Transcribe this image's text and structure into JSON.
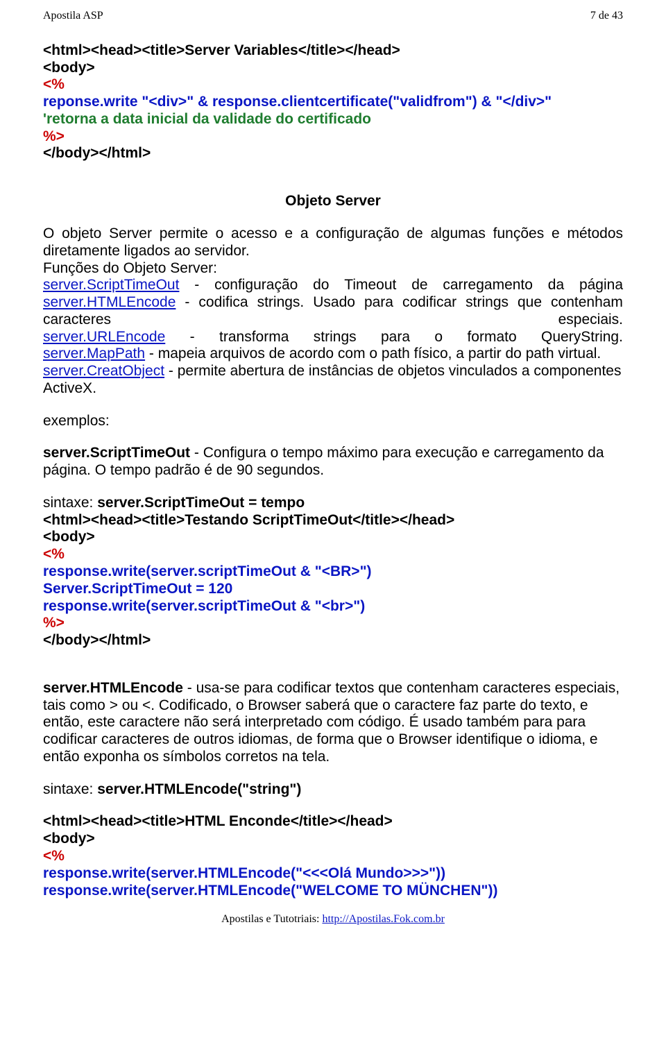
{
  "header": {
    "left": "Apostila ASP",
    "right": "7 de 43"
  },
  "code1": {
    "l1": "<html><head><title>Server Variables</title></head>",
    "l2": "<body>",
    "l3": "<%",
    "l4": "reponse.write \"<div>\" & response.clientcertificate(\"validfrom\") & \"</div>\"",
    "l5": "'retorna a data inicial da validade do certificado",
    "l6": "%>",
    "l7": "</body></html>"
  },
  "server_title": "Objeto Server",
  "server_intro": "O objeto Server permite o acesso e a configuração de algumas funções e métodos diretamente ligados ao servidor.",
  "server_func_label": "Funções do Objeto Server:",
  "srv": {
    "script_label": "server.ScriptTimeOut",
    "script_desc1": " - configuração do Timeout de carregamento da página",
    "html_label": "server.HTMLEncode",
    "html_desc_pre": " - codifica strings. Usado para codificar strings que contenham",
    "html_desc_row": {
      "left": "caracteres",
      "right": "especiais."
    },
    "url_label": "server.URLEncode",
    "url_desc_parts": [
      "-",
      "transforma",
      "strings",
      "para",
      "o",
      "formato",
      "QueryString."
    ],
    "map_label": "server.MapPath",
    "map_desc": " - mapeia arquivos de acordo com o path físico, a partir do path virtual.",
    "creat_label": "server.CreatObject",
    "creat_desc": " - permite abertura de instâncias de objetos vinculados a componentes ActiveX."
  },
  "exemplos_label": "exemplos:",
  "scripttimeout": {
    "label": "server.ScriptTimeOut",
    "desc": " - Configura o tempo máximo para execução e carregamento da página. O tempo padrão é de 90 segundos."
  },
  "syntax1_label": "sintaxe: ",
  "syntax1_val": "server.ScriptTimeOut = tempo",
  "code2": {
    "l1": "<html><head><title>Testando ScriptTimeOut</title></head>",
    "l2": "<body>",
    "l3": "<%",
    "l4": "response.write(server.scriptTimeOut & \"<BR>\")",
    "l5": "Server.ScriptTimeOut = 120",
    "l6": "response.write(server.scriptTimeOut & \"<br>\")",
    "l7": "%>",
    "l8": "</body></html>"
  },
  "htmlencode": {
    "label": "server.HTMLEncode",
    "desc": " - usa-se para codificar textos que contenham caracteres especiais, tais como > ou <. Codificado, o Browser saberá que o caractere faz parte do texto, e então, este caractere não será interpretado com código. É usado também para para codificar caracteres de outros idiomas, de forma que o Browser identifique o idioma, e então exponha os símbolos corretos na tela."
  },
  "syntax2_label": "sintaxe: ",
  "syntax2_val": "server.HTMLEncode(\"string\")",
  "code3": {
    "l1": "<html><head><title>HTML Enconde</title></head>",
    "l2": "<body>",
    "l3": "<%",
    "l4": "response.write(server.HTMLEncode(\"<<<Olá Mundo>>>\"))",
    "l5": "response.write(server.HTMLEncode(\"WELCOME TO MÜNCHEN\"))"
  },
  "footer": {
    "pre": "Apostilas e Tutotriais: ",
    "link": "http://Apostilas.Fok.com.br"
  }
}
